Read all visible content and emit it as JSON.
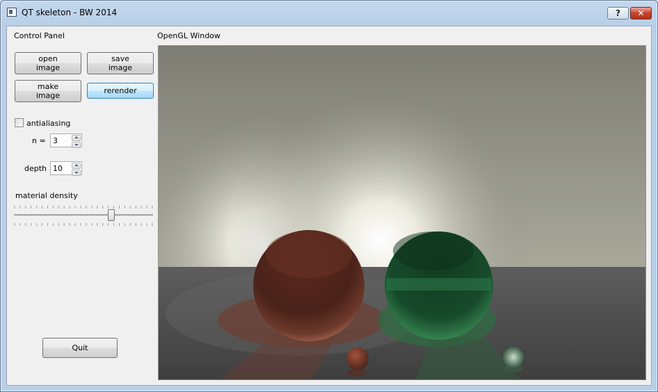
{
  "window": {
    "title": "QT skeleton - BW 2014",
    "help_label": "?",
    "close_label": "✕"
  },
  "control_panel": {
    "title": "Control Panel",
    "buttons": {
      "open_image": "open\nimage",
      "save_image": "save\nimage",
      "make_image": "make\nimage",
      "rerender": "rerender"
    },
    "antialiasing": {
      "label": "antialiasing",
      "checked": false
    },
    "n": {
      "label": "n =",
      "value": "3"
    },
    "depth": {
      "label": "depth",
      "value": "10"
    },
    "material_density": {
      "label": "material density",
      "level_fraction": 0.7
    },
    "quit_label": "Quit"
  },
  "opengl": {
    "title": "OpenGL Window",
    "scene": {
      "spheres": [
        {
          "name": "large-red-sphere",
          "color": "#7a3a2a"
        },
        {
          "name": "large-green-sphere",
          "color": "#1f6a3a"
        },
        {
          "name": "small-red-sphere",
          "color": "#8a3f30"
        },
        {
          "name": "small-glass-sphere",
          "color": "#6a8a70"
        }
      ],
      "wall_color": "#8c8b80",
      "floor_color": "#4a4a4a"
    }
  },
  "colors": {
    "hot_button": "#bee6fd",
    "close_button": "#c6432b",
    "panel_bg": "#f0f0f0"
  }
}
